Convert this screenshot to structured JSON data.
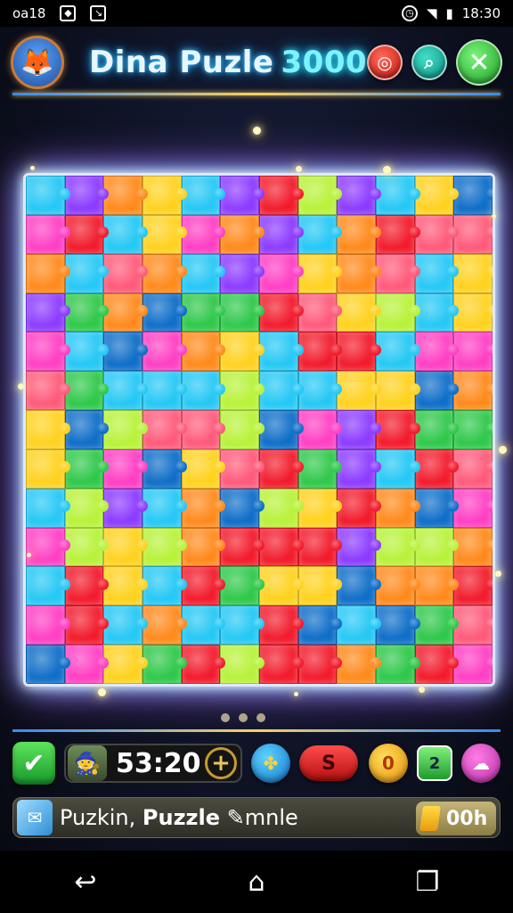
{
  "status_bar": {
    "carrier": "oa18",
    "time": "18:30"
  },
  "header": {
    "title": "Dina Puzle",
    "score": "3000"
  },
  "board": {
    "columns": 12,
    "rows": 13,
    "palette": [
      "#f21b2c",
      "#ff8a1c",
      "#ffd21f",
      "#2fc84a",
      "#25c8f5",
      "#8c3bff",
      "#ff3fc4",
      "#0f6ec8",
      "#b8f23a",
      "#ff5a7a"
    ]
  },
  "pager": {
    "pages": 3
  },
  "toolbar": {
    "timer": "53:20",
    "plus_label": "+",
    "pill_label": "S",
    "coin_label": "0",
    "hint_label": "2"
  },
  "bottom_bar": {
    "label_plain": "Puzkin,",
    "label_bold": "Puzzle",
    "label_tail": "mnle",
    "coins": "00h"
  }
}
